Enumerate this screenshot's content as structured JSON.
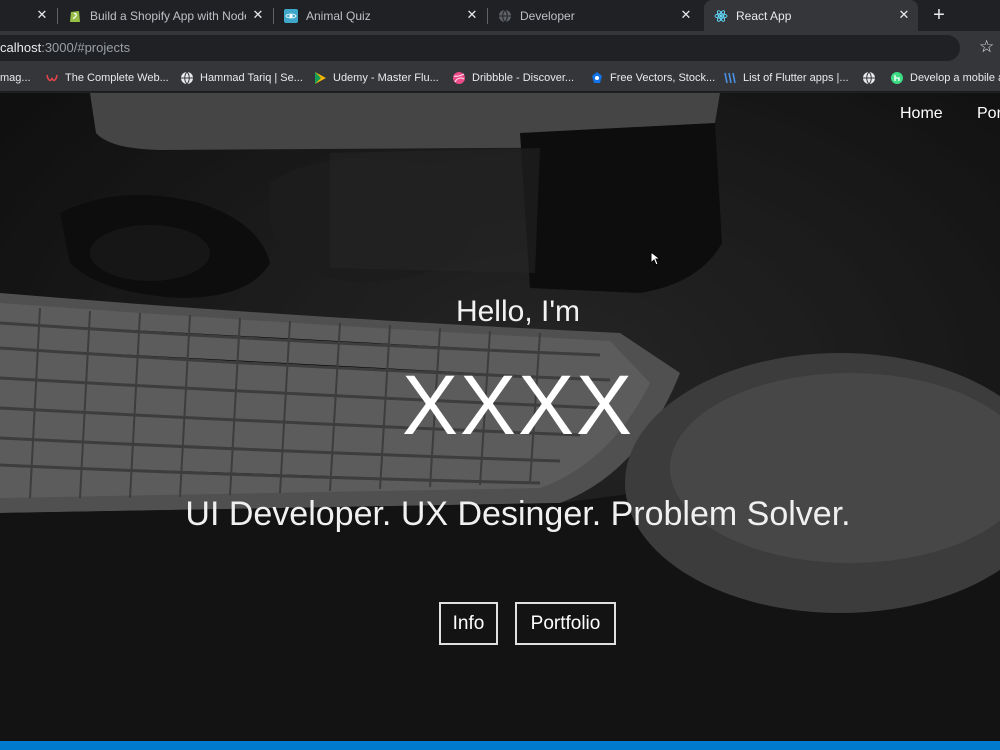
{
  "browser": {
    "tabs": [
      {
        "label": "",
        "active": false
      },
      {
        "label": "Build a Shopify App with Node.js",
        "active": false
      },
      {
        "label": "Animal Quiz",
        "active": false
      },
      {
        "label": "Developer",
        "active": false
      },
      {
        "label": "React App",
        "active": true
      }
    ],
    "new_tab": "+",
    "address": {
      "host": "calhost",
      "path": ":3000/#projects"
    },
    "bookmarks": [
      "mag...",
      "The Complete Web...",
      "Hammad Tariq | Se...",
      "Udemy - Master Flu...",
      "Dribbble - Discover...",
      "Free Vectors, Stock...",
      "List of Flutter apps |...",
      "",
      "Develop a mobile a"
    ]
  },
  "site": {
    "nav": {
      "home": "Home",
      "portfolio": "Por"
    },
    "hero": {
      "greeting": "Hello, I'm",
      "name": "XXXX",
      "tagline": "UI Developer. UX Desinger. Problem Solver.",
      "buttons": {
        "info": "Info",
        "portfolio": "Portfolio"
      }
    }
  },
  "colors": {
    "statusbar": "#007acc",
    "tab_bar": "#202124",
    "toolbar": "#35363a"
  }
}
